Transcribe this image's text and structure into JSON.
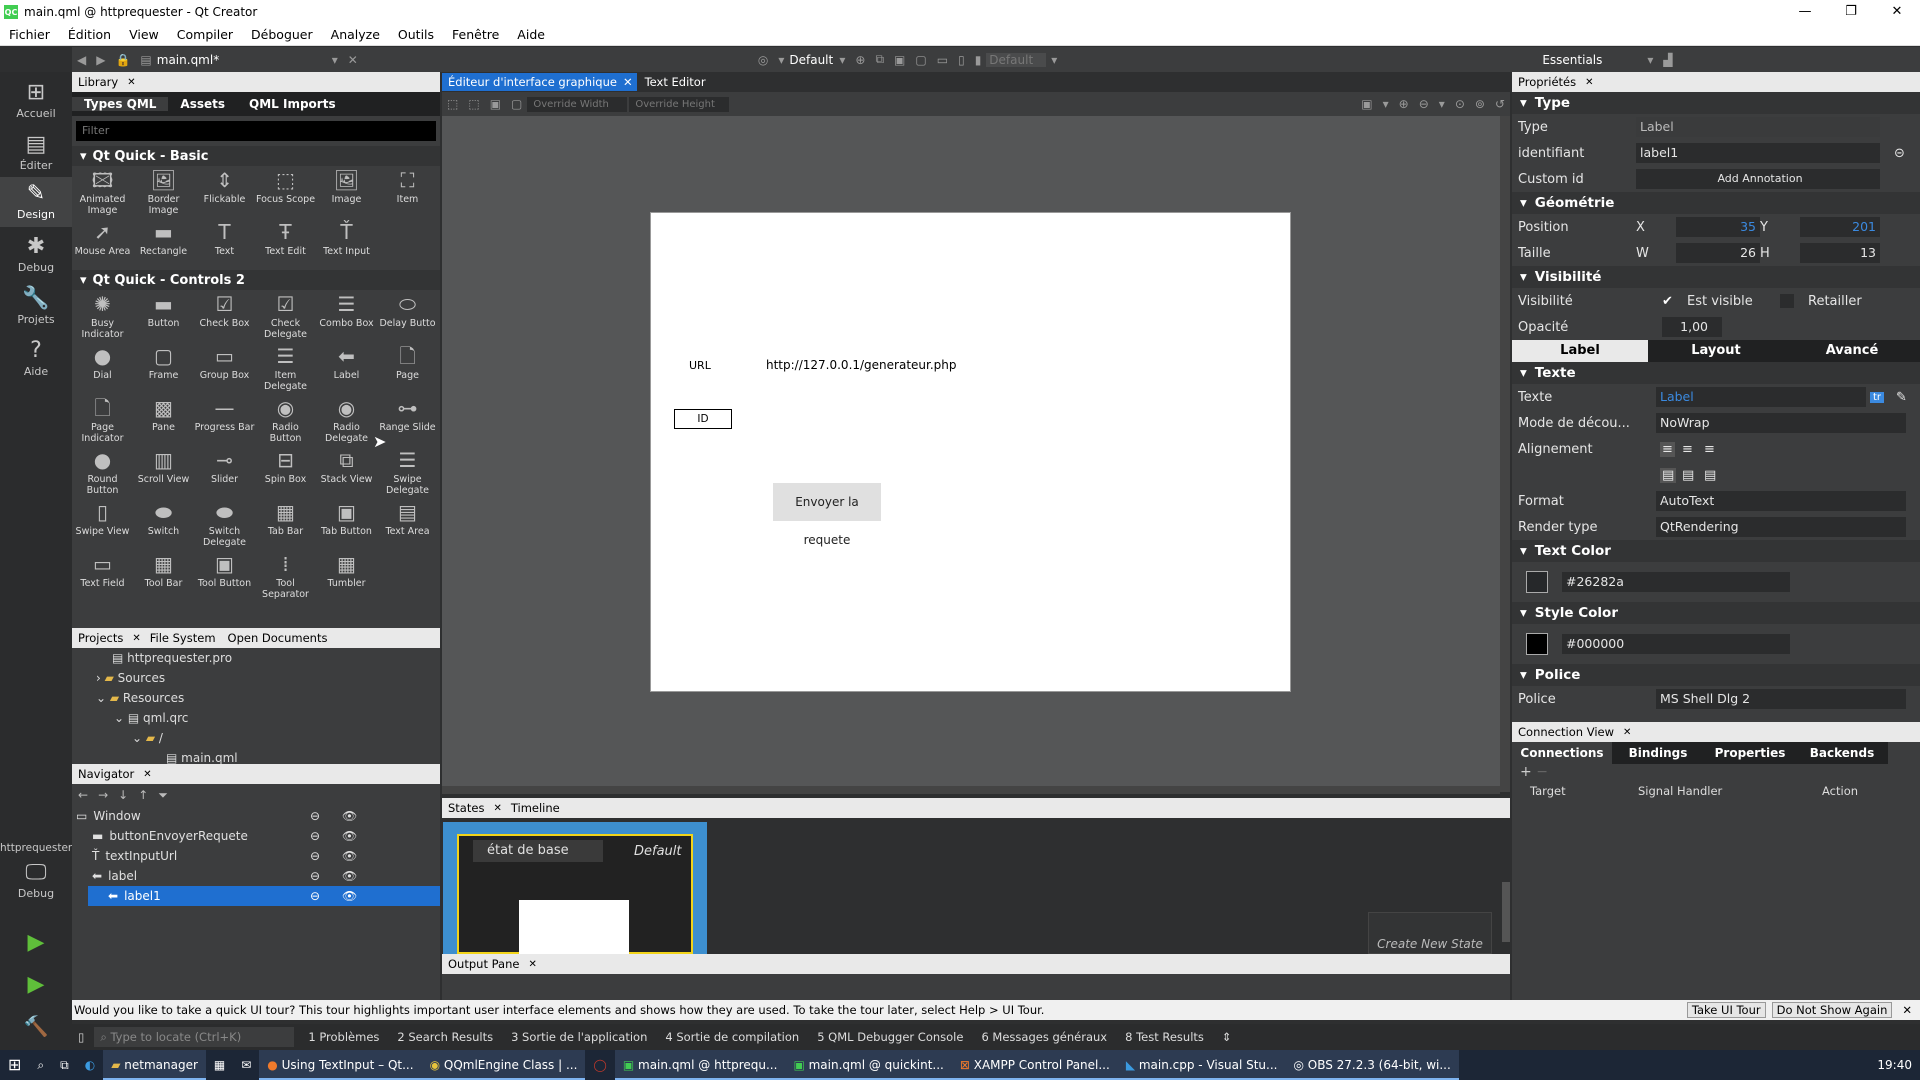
{
  "window": {
    "title": "main.qml @ httprequester - Qt Creator",
    "logo": "QC",
    "buttons": [
      "—",
      "❐",
      "✕"
    ]
  },
  "menu": [
    "Fichier",
    "Édition",
    "View",
    "Compiler",
    "Déboguer",
    "Analyze",
    "Outils",
    "Fenêtre",
    "Aide"
  ],
  "toolbar": {
    "file": "main.qml*",
    "style": "Default",
    "style2": "Default",
    "workspace": "Essentials"
  },
  "modes": [
    {
      "label": "Accueil",
      "icon": "⊞"
    },
    {
      "label": "Éditer",
      "icon": "▤"
    },
    {
      "label": "Design",
      "icon": "✎"
    },
    {
      "label": "Debug",
      "icon": "✱"
    },
    {
      "label": "Projets",
      "icon": "🔧"
    },
    {
      "label": "Aide",
      "icon": "?"
    }
  ],
  "kit": {
    "project": "httprequester",
    "mode": "Debug"
  },
  "library": {
    "tab": "Library",
    "subtabs": [
      "Types QML",
      "Assets",
      "QML Imports"
    ],
    "filter_placeholder": "Filter",
    "sections": [
      {
        "title": "Qt Quick - Basic",
        "items": [
          "Animated Image",
          "Border Image",
          "Flickable",
          "Focus Scope",
          "Image",
          "Item",
          "Mouse Area",
          "Rectangle",
          "Text",
          "Text Edit",
          "Text Input"
        ]
      },
      {
        "title": "Qt Quick - Controls 2",
        "items": [
          "Busy Indicator",
          "Button",
          "Check Box",
          "Check Delegate",
          "Combo Box",
          "Delay Butto",
          "Dial",
          "Frame",
          "Group Box",
          "Item Delegate",
          "Label",
          "Page",
          "Page Indicator",
          "Pane",
          "Progress Bar",
          "Radio Button",
          "Radio Delegate",
          "Range Slide",
          "Round Button",
          "Scroll View",
          "Slider",
          "Spin Box",
          "Stack View",
          "Swipe Delegate",
          "Swipe View",
          "Switch",
          "Switch Delegate",
          "Tab Bar",
          "Tab Button",
          "Text Area",
          "Text Field",
          "Tool Bar",
          "Tool Button",
          "Tool Separator",
          "Tumbler"
        ]
      }
    ]
  },
  "projects": {
    "tabs": [
      "Projects",
      "File System",
      "Open Documents"
    ],
    "tree": [
      "httprequester.pro",
      "Sources",
      "Resources",
      "qml.qrc",
      "/",
      "main.qml"
    ]
  },
  "navigator": {
    "tab": "Navigator",
    "items": [
      "Window",
      "buttonEnvoyerRequete",
      "textInputUrl",
      "label",
      "label1"
    ]
  },
  "editor": {
    "tabs": [
      "Éditeur d'interface graphique",
      "Text Editor"
    ],
    "override_width": "Override Width",
    "override_height": "Override Height",
    "form": {
      "url_label": "URL",
      "url_value": "http://127.0.0.1/generateur.php",
      "id_label": "ID",
      "send_button": "Envoyer la requete"
    }
  },
  "states": {
    "tabs": [
      "States",
      "Timeline"
    ],
    "base_state": "état de base",
    "default": "Default",
    "create": "Create New State"
  },
  "output": {
    "tab": "Output Pane"
  },
  "properties": {
    "tab": "Propriétés",
    "type_section": "Type",
    "type_label": "Type",
    "type_value": "Label",
    "id_label": "identifiant",
    "id_value": "label1",
    "custom_id": "Custom id",
    "add_annotation": "Add Annotation",
    "geometry": "Géométrie",
    "position": "Position",
    "x_label": "X",
    "x_value": "35",
    "y_label": "Y",
    "y_value": "201",
    "size": "Taille",
    "w_label": "W",
    "w_value": "26",
    "h_label": "H",
    "h_value": "13",
    "visibility_section": "Visibilité",
    "visibility": "Visibilité",
    "is_visible": "Est visible",
    "clip": "Retailler",
    "opacity": "Opacité",
    "opacity_value": "1,00",
    "tabs": [
      "Label",
      "Layout",
      "Avancé"
    ],
    "text_section": "Texte",
    "text_label": "Texte",
    "text_value": "Label",
    "wrap_label": "Mode de décou...",
    "wrap_value": "NoWrap",
    "align_label": "Alignement",
    "format_label": "Format",
    "format_value": "AutoText",
    "render_label": "Render type",
    "render_value": "QtRendering",
    "text_color_section": "Text Color",
    "text_color": "#26282a",
    "style_color_section": "Style Color",
    "style_color": "#000000",
    "font_section": "Police",
    "font_label": "Police",
    "font_value": "MS Shell Dlg 2"
  },
  "connection": {
    "tab": "Connection View",
    "tabs": [
      "Connections",
      "Bindings",
      "Properties",
      "Backends"
    ],
    "columns": [
      "Target",
      "Signal Handler",
      "Action"
    ]
  },
  "tip": {
    "text": "Would you like to take a quick UI tour? This tour highlights important user interface elements and shows how they are used. To take the tour later, select Help > UI Tour.",
    "take": "Take UI Tour",
    "dont": "Do Not Show Again"
  },
  "status": {
    "locate_placeholder": "Type to locate (Ctrl+K)",
    "items": [
      "1  Problèmes",
      "2  Search Results",
      "3  Sortie de l'application",
      "4  Sortie de compilation",
      "5  QML Debugger Console",
      "6  Messages généraux",
      "8  Test Results"
    ]
  },
  "taskbar": {
    "items": [
      "netmanager",
      "Using TextInput – Qt...",
      "QQmlEngine Class | ...",
      "main.qml @ httprequ...",
      "main.qml @ quickint...",
      "XAMPP Control Panel...",
      "main.cpp - Visual Stu...",
      "OBS 27.2.3 (64-bit, wi..."
    ],
    "clock": "19:40"
  },
  "colors": {
    "accent": "#1f6fd0",
    "text_color": "#26282a",
    "style_color": "#000000"
  }
}
